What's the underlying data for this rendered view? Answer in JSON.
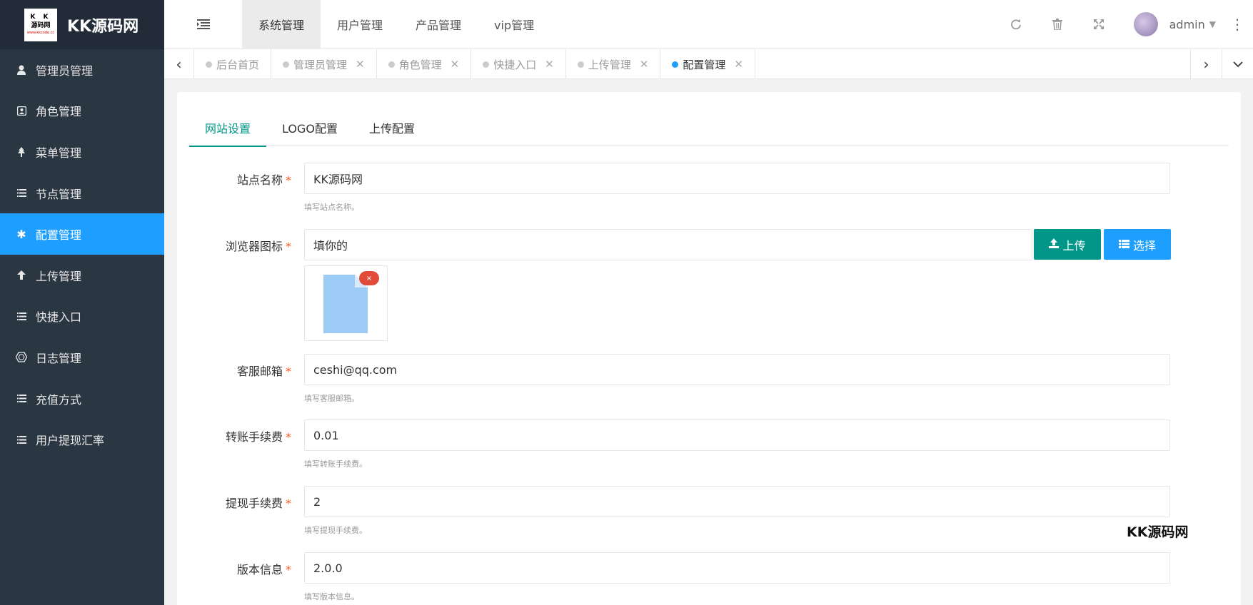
{
  "brand": {
    "logo_line1": "K K",
    "logo_line2": "源码网",
    "logo_line3": "www.kkcode.cc",
    "title": "KK源码网"
  },
  "sidebar": {
    "items": [
      {
        "label": "管理员管理",
        "icon": "user-icon"
      },
      {
        "label": "角色管理",
        "icon": "role-icon"
      },
      {
        "label": "菜单管理",
        "icon": "tree-icon"
      },
      {
        "label": "节点管理",
        "icon": "list-icon"
      },
      {
        "label": "配置管理",
        "icon": "gear-icon",
        "active": true
      },
      {
        "label": "上传管理",
        "icon": "arrow-up-icon"
      },
      {
        "label": "快捷入口",
        "icon": "list-icon"
      },
      {
        "label": "日志管理",
        "icon": "hexagon-icon"
      },
      {
        "label": "充值方式",
        "icon": "list-icon"
      },
      {
        "label": "用户提现汇率",
        "icon": "list-icon"
      }
    ]
  },
  "topnav": {
    "items": [
      "系统管理",
      "用户管理",
      "产品管理",
      "vip管理"
    ],
    "active": "系统管理"
  },
  "header": {
    "username": "admin"
  },
  "page_tabs": [
    {
      "label": "后台首页",
      "closable": false
    },
    {
      "label": "管理员管理",
      "closable": true
    },
    {
      "label": "角色管理",
      "closable": true
    },
    {
      "label": "快捷入口",
      "closable": true
    },
    {
      "label": "上传管理",
      "closable": true
    },
    {
      "label": "配置管理",
      "closable": true,
      "active": true
    }
  ],
  "config_tabs": [
    "网站设置",
    "LOGO配置",
    "上传配置"
  ],
  "form": {
    "site_name": {
      "label": "站点名称",
      "value": "KK源码网",
      "hint": "填写站点名称。"
    },
    "favicon": {
      "label": "浏览器图标",
      "value": "填你的",
      "upload_label": "上传",
      "select_label": "选择",
      "delete_glyph": "×"
    },
    "email": {
      "label": "客服邮箱",
      "value": "ceshi@qq.com",
      "hint": "填写客服邮箱。"
    },
    "transfer_fee": {
      "label": "转账手续费",
      "value": "0.01",
      "hint": "填写转账手续费。"
    },
    "withdraw_fee": {
      "label": "提现手续费",
      "value": "2",
      "hint": "填写提现手续费。"
    },
    "version": {
      "label": "版本信息",
      "value": "2.0.0",
      "hint": "填写版本信息。"
    }
  },
  "watermark": "KK源码网",
  "colors": {
    "sidebar_bg": "#2b3643",
    "active_blue": "#1e9fff",
    "teal": "#009688",
    "required": "#ff5722"
  }
}
